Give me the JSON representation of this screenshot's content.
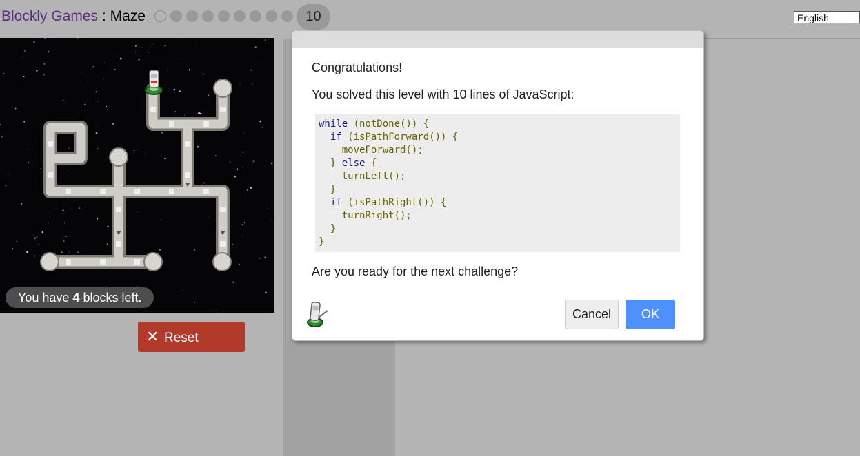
{
  "header": {
    "app_name": "Blockly Games",
    "separator": " : ",
    "game_name": "Maze",
    "current_level": "10",
    "language": "English"
  },
  "maze": {
    "blocks_left_prefix": "You have ",
    "blocks_left_count": "4",
    "blocks_left_suffix": " blocks left."
  },
  "controls": {
    "reset_label": "Reset"
  },
  "dialog": {
    "congrats": "Congratulations!",
    "solved_text": "You solved this level with 10 lines of JavaScript:",
    "code_lines": [
      [
        {
          "t": "while",
          "c": "kw"
        },
        {
          "t": " (notDone()) ",
          "c": "pn"
        },
        {
          "t": "{",
          "c": "pn"
        }
      ],
      [
        {
          "t": "  "
        },
        {
          "t": "if",
          "c": "kw"
        },
        {
          "t": " (isPathForward()) {",
          "c": "pn"
        }
      ],
      [
        {
          "t": "    moveForward();",
          "c": "pn"
        }
      ],
      [
        {
          "t": "  } ",
          "c": "pn"
        },
        {
          "t": "else",
          "c": "kw"
        },
        {
          "t": " {",
          "c": "pn"
        }
      ],
      [
        {
          "t": "    turnLeft();",
          "c": "pn"
        }
      ],
      [
        {
          "t": "  }",
          "c": "pn"
        }
      ],
      [
        {
          "t": "  "
        },
        {
          "t": "if",
          "c": "kw"
        },
        {
          "t": " (isPathRight()) {",
          "c": "pn"
        }
      ],
      [
        {
          "t": "    turnRight();",
          "c": "pn"
        }
      ],
      [
        {
          "t": "  }",
          "c": "pn"
        }
      ],
      [
        {
          "t": "}",
          "c": "pn"
        }
      ]
    ],
    "next_text": "Are you ready for the next challenge?",
    "cancel_label": "Cancel",
    "ok_label": "OK"
  }
}
